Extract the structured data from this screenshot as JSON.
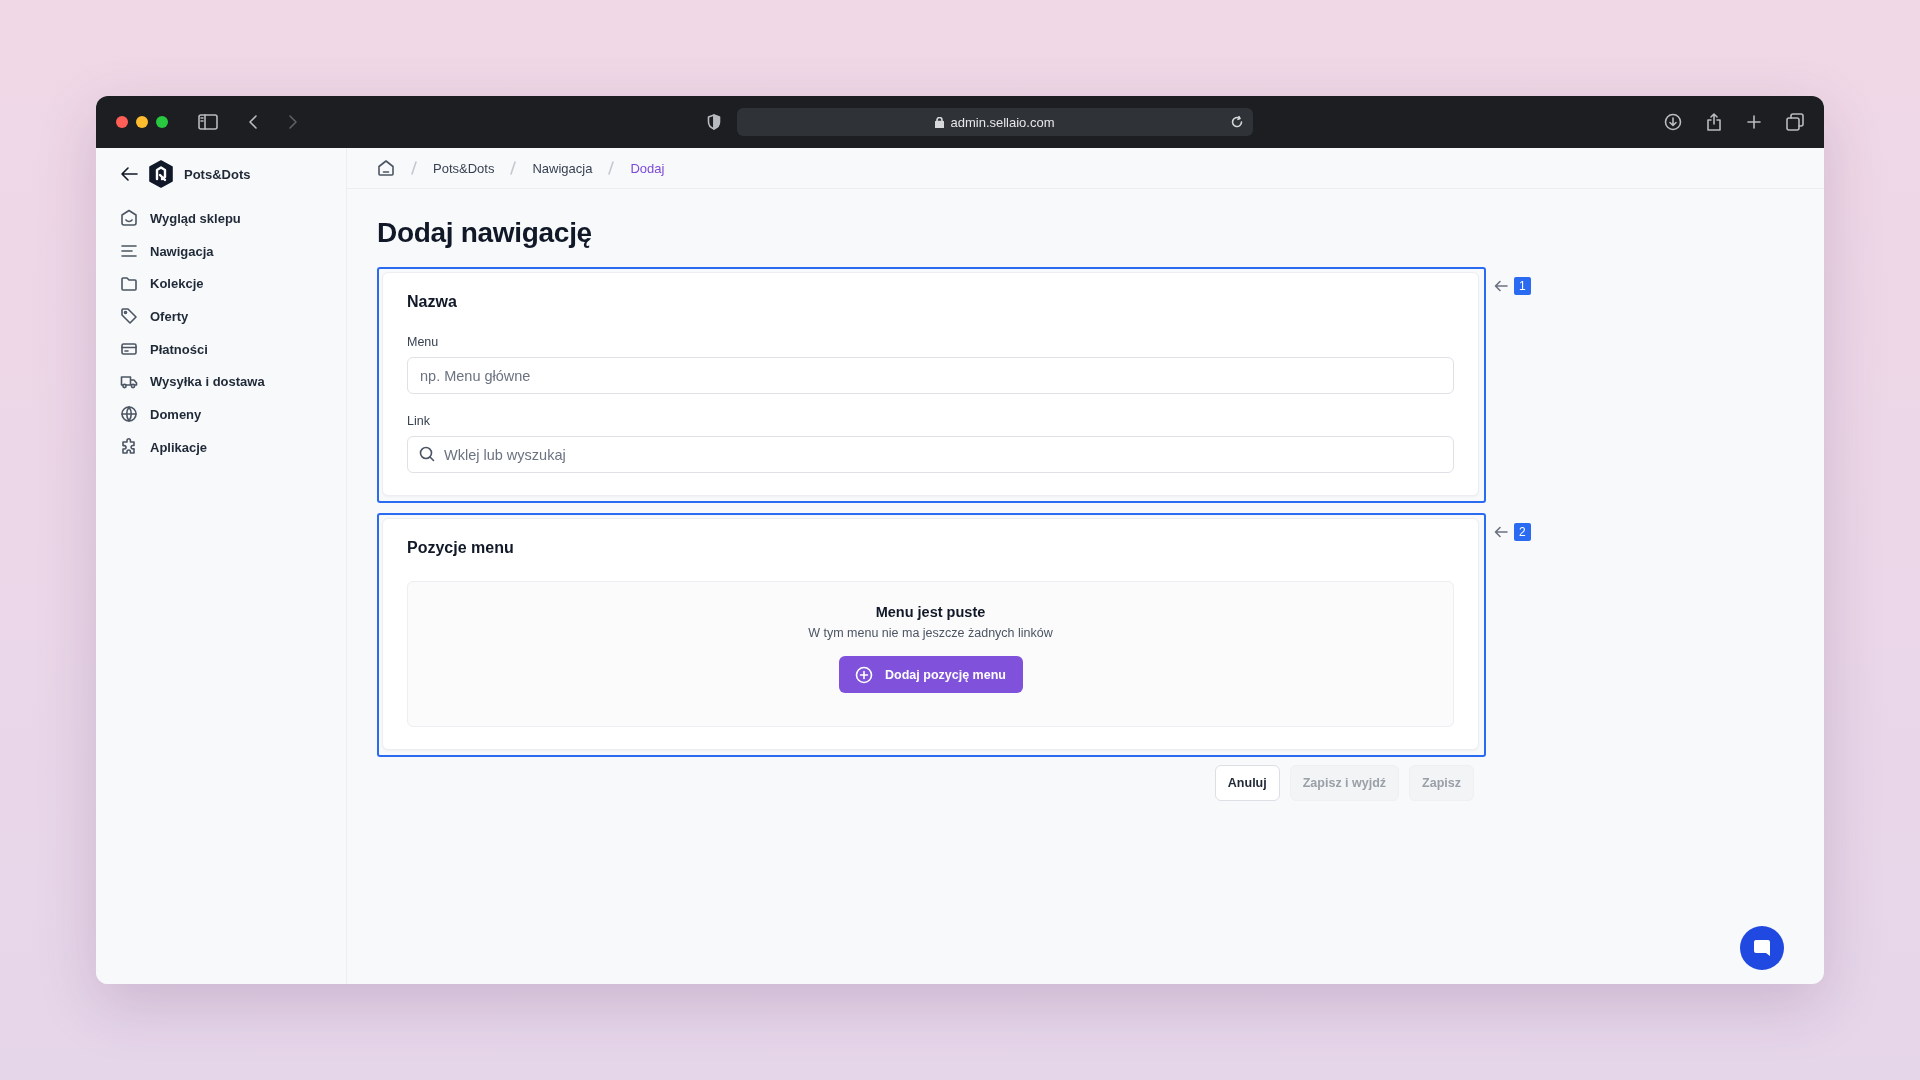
{
  "browser": {
    "url": "admin.sellaio.com"
  },
  "sidebar": {
    "store_name": "Pots&Dots",
    "items": [
      {
        "label": "Wygląd sklepu"
      },
      {
        "label": "Nawigacja"
      },
      {
        "label": "Kolekcje"
      },
      {
        "label": "Oferty"
      },
      {
        "label": "Płatności"
      },
      {
        "label": "Wysyłka i dostawa"
      },
      {
        "label": "Domeny"
      },
      {
        "label": "Aplikacje"
      }
    ]
  },
  "breadcrumb": [
    {
      "label": "Pots&Dots",
      "selected": false
    },
    {
      "label": "Nawigacja",
      "selected": false
    },
    {
      "label": "Dodaj",
      "selected": true
    }
  ],
  "title": "Dodaj nawigację",
  "sections": [
    {
      "kind": "fields",
      "title": "Nazwa",
      "annotation": "1",
      "fields": [
        {
          "label": "Menu",
          "placeholder": "np. Menu główne",
          "kind": "text"
        },
        {
          "label": "Link",
          "placeholder": "Wklej lub wyszukaj",
          "kind": "search"
        }
      ]
    },
    {
      "kind": "empty",
      "title": "Pozycje menu",
      "annotation": "2",
      "empty_title": "Menu jest puste",
      "empty_text": "W tym menu nie ma jeszcze żadnych linków",
      "button": "Dodaj pozycję menu"
    }
  ],
  "actions": [
    {
      "label": "Anuluj",
      "disabled": false
    },
    {
      "label": "Zapisz i wyjdź",
      "disabled": true
    },
    {
      "label": "Zapisz",
      "disabled": true
    }
  ]
}
